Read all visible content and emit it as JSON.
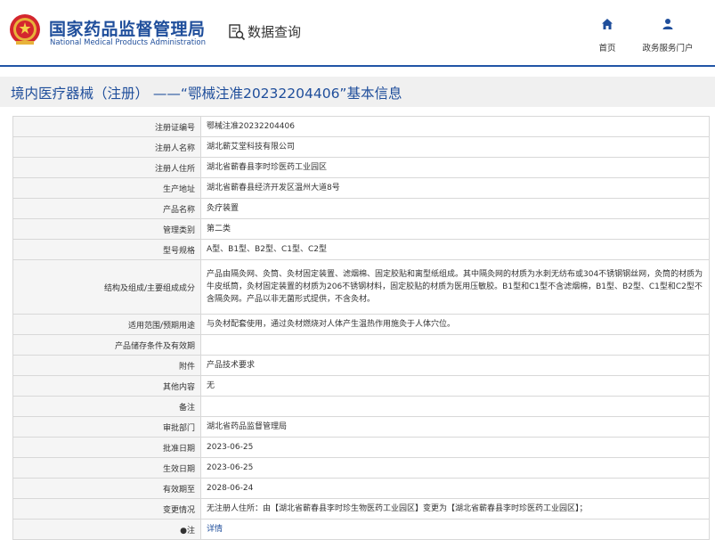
{
  "header": {
    "logo_cn": "国家药品监督管理局",
    "logo_en": "National Medical Products Administration",
    "query_label": "数据查询",
    "nav": {
      "home_label": "首页",
      "portal_label": "政务服务门户"
    }
  },
  "page_title": "境内医疗器械（注册） ——“鄂械注准20232204406”基本信息",
  "colors": {
    "brand_blue": "#1f4e9b",
    "title_bar_bg": "#f0f0f0",
    "label_bg": "#f5f5f5",
    "border": "#d8d8d8"
  },
  "rows": [
    {
      "label": "注册证编号",
      "value": "鄂械注准20232204406"
    },
    {
      "label": "注册人名称",
      "value": "湖北蕲艾堂科技有限公司"
    },
    {
      "label": "注册人住所",
      "value": "湖北省蕲春县李时珍医药工业园区"
    },
    {
      "label": "生产地址",
      "value": "湖北省蕲春县经济开发区温州大道8号"
    },
    {
      "label": "产品名称",
      "value": "灸疗装置"
    },
    {
      "label": "管理类别",
      "value": "第二类"
    },
    {
      "label": "型号规格",
      "value": "A型、B1型、B2型、C1型、C2型"
    },
    {
      "label": "结构及组成/主要组成成分",
      "value": "产品由隔灸网、灸筒、灸材固定装置、滤烟棉、固定胶贴和离型纸组成。其中隔灸网的材质为水刺无纺布或304不锈钢钢丝网，灸筒的材质为牛皮纸筒，灸材固定装置的材质为206不锈钢材料，固定胶贴的材质为医用压敏胶。B1型和C1型不含滤烟棉，B1型、B2型、C1型和C2型不含隔灸网。产品以非无菌形式提供，不含灸材。"
    },
    {
      "label": "适用范围/预期用途",
      "value": "与灸材配套使用，通过灸材燃烧对人体产生温热作用施灸于人体穴位。"
    },
    {
      "label": "产品储存条件及有效期",
      "value": ""
    },
    {
      "label": "附件",
      "value": "产品技术要求"
    },
    {
      "label": "其他内容",
      "value": "无"
    },
    {
      "label": "备注",
      "value": ""
    },
    {
      "label": "审批部门",
      "value": "湖北省药品监督管理局"
    },
    {
      "label": "批准日期",
      "value": "2023-06-25"
    },
    {
      "label": "生效日期",
      "value": "2023-06-25"
    },
    {
      "label": "有效期至",
      "value": "2028-06-24"
    },
    {
      "label": "变更情况",
      "value": "无注册人住所：由【湖北省蕲春县李时珍生物医药工业园区】变更为【湖北省蕲春县李时珍医药工业园区】；"
    },
    {
      "label": "注",
      "value": "详情"
    }
  ]
}
